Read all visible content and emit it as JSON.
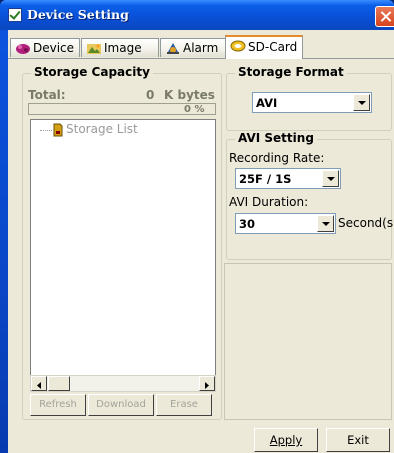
{
  "window": {
    "title": "Device Setting"
  },
  "tabs": [
    {
      "label": "Device",
      "icon": "device-icon",
      "active": false
    },
    {
      "label": "Image",
      "icon": "image-icon",
      "active": false
    },
    {
      "label": "Alarm",
      "icon": "alarm-icon",
      "active": false
    },
    {
      "label": "SD-Card",
      "icon": "sd-card-icon",
      "active": true
    }
  ],
  "storage_capacity": {
    "title": "Storage Capacity",
    "total_label": "Total:",
    "total_value": "0",
    "total_unit": "K bytes",
    "usage_percent": "0 %",
    "usage_fraction": 0,
    "tree_item": "Storage List",
    "buttons": {
      "refresh": "Refresh",
      "download": "Download",
      "erase": "Erase"
    }
  },
  "storage_format": {
    "title": "Storage Format",
    "selected": "AVI"
  },
  "avi_setting": {
    "title": "AVI Setting",
    "rate_label": "Recording Rate:",
    "rate_value": "25F / 1S",
    "duration_label": "AVI Duration:",
    "duration_value": "30",
    "duration_unit": "Second(s)"
  },
  "footer": {
    "apply": "Apply",
    "exit": "Exit"
  }
}
